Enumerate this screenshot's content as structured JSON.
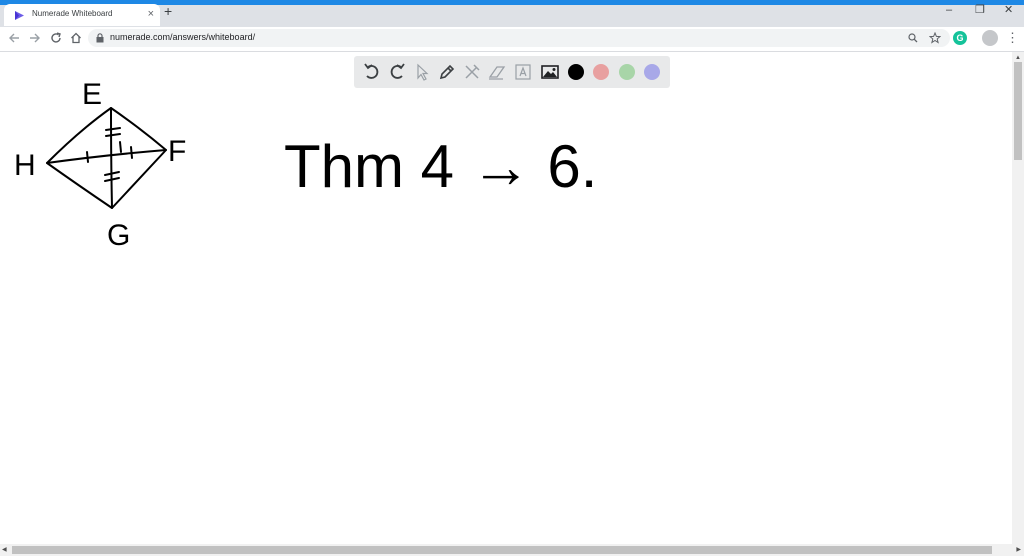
{
  "browser": {
    "tab_title": "Numerade Whiteboard",
    "tab_close": "×",
    "new_tab": "+",
    "url": "numerade.com/answers/whiteboard/",
    "window_controls": [
      "–",
      "❐",
      "✕"
    ],
    "profile_extension_letter": "G"
  },
  "whiteboard": {
    "tools": [
      "undo-icon",
      "redo-icon",
      "pointer-icon",
      "pen-icon",
      "tools-icon",
      "eraser-icon",
      "text-icon",
      "image-icon"
    ],
    "colors": [
      "#000000",
      "#e8a0a0",
      "#a8d5a8",
      "#a8a8e8"
    ],
    "drawing": {
      "vertex_labels": [
        "E",
        "F",
        "G",
        "H"
      ],
      "theorem_text": "Thm 4 → 6."
    }
  },
  "colors": {
    "accent_stripe": "#1e88e5",
    "tab_strip": "#dee1e6",
    "whiteboard_toolbar": "#e8e9ea"
  }
}
